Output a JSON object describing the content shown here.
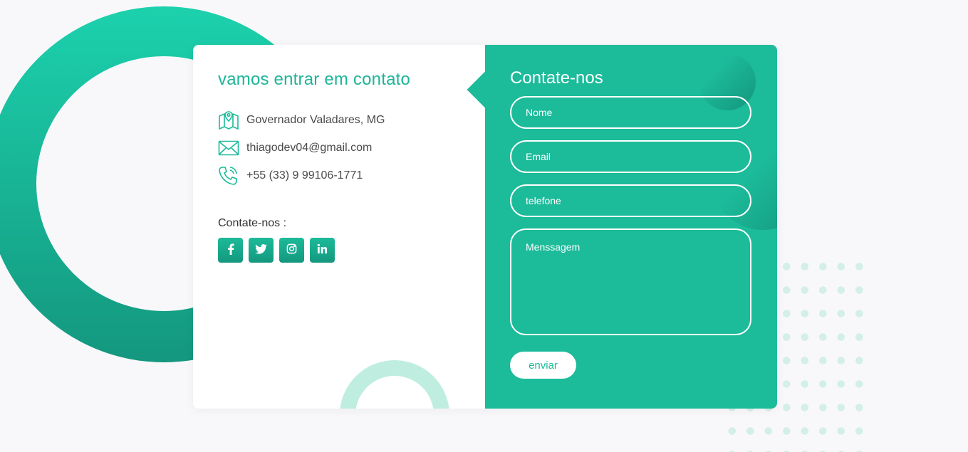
{
  "contact_info": {
    "title": "vamos entrar em contato",
    "items": [
      {
        "icon": "map-icon",
        "text": "Governador Valadares, MG"
      },
      {
        "icon": "mail-icon",
        "text": "thiagodev04@gmail.com"
      },
      {
        "icon": "phone-icon",
        "text": "+55 (33) 9 99106-1771"
      }
    ],
    "social_title": "Contate-nos :",
    "social": [
      {
        "icon": "facebook-icon",
        "glyph": "f"
      },
      {
        "icon": "twitter-icon",
        "glyph": "t"
      },
      {
        "icon": "instagram-icon",
        "glyph": "ig"
      },
      {
        "icon": "linkedin-icon",
        "glyph": "in"
      }
    ]
  },
  "form": {
    "title": "Contate-nos",
    "name_placeholder": "Nome",
    "email_placeholder": "Email",
    "phone_placeholder": "telefone",
    "message_placeholder": "Menssagem",
    "submit_label": "enviar"
  },
  "colors": {
    "accent": "#1cbb9a",
    "accent_dark": "#14977e",
    "ring_light": "#bfeee0",
    "background": "#f8f8fa"
  }
}
